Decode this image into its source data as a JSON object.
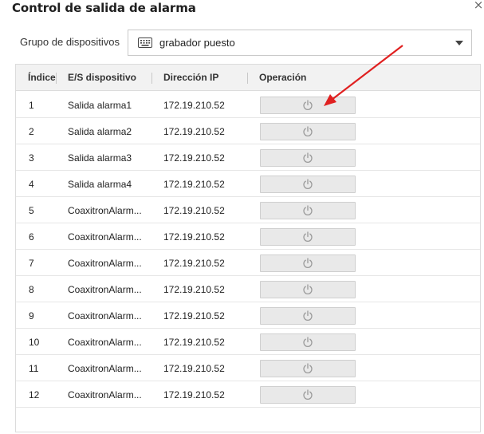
{
  "dialog": {
    "title": "Control de salida de alarma",
    "close_glyph": "×"
  },
  "group": {
    "label": "Grupo de dispositivos",
    "selected": "grabador puesto",
    "icon": "keyboard-icon"
  },
  "table": {
    "headers": {
      "index": "Índice",
      "device": "E/S dispositivo",
      "ip": "Dirección IP",
      "operation": "Operación"
    },
    "rows": [
      {
        "index": "1",
        "device": "Salida alarma1",
        "ip": "172.19.210.52"
      },
      {
        "index": "2",
        "device": "Salida alarma2",
        "ip": "172.19.210.52"
      },
      {
        "index": "3",
        "device": "Salida alarma3",
        "ip": "172.19.210.52"
      },
      {
        "index": "4",
        "device": "Salida alarma4",
        "ip": "172.19.210.52"
      },
      {
        "index": "5",
        "device": "CoaxitronAlarm...",
        "ip": "172.19.210.52"
      },
      {
        "index": "6",
        "device": "CoaxitronAlarm...",
        "ip": "172.19.210.52"
      },
      {
        "index": "7",
        "device": "CoaxitronAlarm...",
        "ip": "172.19.210.52"
      },
      {
        "index": "8",
        "device": "CoaxitronAlarm...",
        "ip": "172.19.210.52"
      },
      {
        "index": "9",
        "device": "CoaxitronAlarm...",
        "ip": "172.19.210.52"
      },
      {
        "index": "10",
        "device": "CoaxitronAlarm...",
        "ip": "172.19.210.52"
      },
      {
        "index": "11",
        "device": "CoaxitronAlarm...",
        "ip": "172.19.210.52"
      },
      {
        "index": "12",
        "device": "CoaxitronAlarm...",
        "ip": "172.19.210.52"
      }
    ],
    "operation_icon": "power-icon"
  },
  "annotation": {
    "arrow_color": "#e02020"
  }
}
